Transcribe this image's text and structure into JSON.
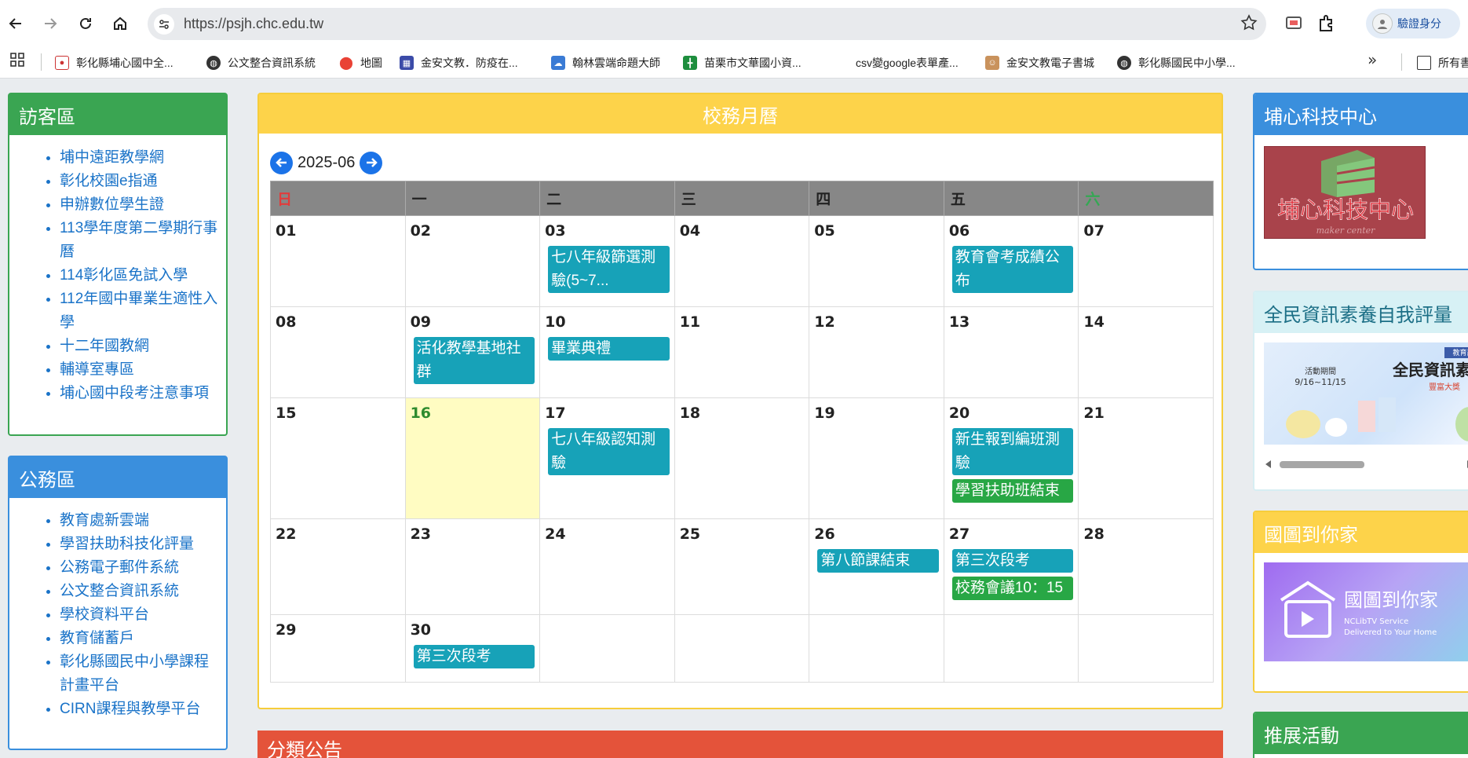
{
  "browser": {
    "url": "https://psjh.chc.edu.tw",
    "verify_label": "驗證身分",
    "bookmarks": [
      "彰化縣埔心國中全...",
      "公文整合資訊系統",
      "地圖",
      "金安文教．防疫在...",
      "翰林雲端命題大師",
      "苗栗市文華國小資...",
      "csv變google表單產...",
      "金安文教電子書城",
      "彰化縣國民中小學..."
    ],
    "all_bookmarks_label": "所有書"
  },
  "visitor": {
    "title": "訪客區",
    "links": [
      "埔中遠距教學網",
      "彰化校園e指通",
      "申辦數位學生證",
      "113學年度第二學期行事曆",
      "114彰化區免試入學",
      "112年國中畢業生適性入學",
      "十二年國教網",
      "輔導室專區",
      "埔心國中段考注意事項"
    ]
  },
  "official": {
    "title": "公務區",
    "links": [
      "教育處新雲端",
      "學習扶助科技化評量",
      "公務電子郵件系統",
      "公文整合資訊系統",
      "學校資料平台",
      "教育儲蓄戶",
      "彰化縣國民中小學課程計畫平台",
      "CIRN課程與教學平台"
    ]
  },
  "calendar": {
    "title": "校務月曆",
    "month": "2025-06",
    "weekdays": [
      "日",
      "一",
      "二",
      "三",
      "四",
      "五",
      "六"
    ],
    "weeks": [
      [
        {
          "day": "01",
          "events": []
        },
        {
          "day": "02",
          "events": []
        },
        {
          "day": "03",
          "events": [
            {
              "text": "七八年級篩選測驗(5~7...",
              "color": "teal"
            }
          ]
        },
        {
          "day": "04",
          "events": []
        },
        {
          "day": "05",
          "events": []
        },
        {
          "day": "06",
          "events": [
            {
              "text": "教育會考成績公布",
              "color": "teal"
            }
          ]
        },
        {
          "day": "07",
          "events": []
        }
      ],
      [
        {
          "day": "08",
          "events": []
        },
        {
          "day": "09",
          "events": [
            {
              "text": "活化教學基地社群",
              "color": "teal"
            }
          ]
        },
        {
          "day": "10",
          "events": [
            {
              "text": "畢業典禮",
              "color": "teal"
            }
          ]
        },
        {
          "day": "11",
          "events": []
        },
        {
          "day": "12",
          "events": []
        },
        {
          "day": "13",
          "events": []
        },
        {
          "day": "14",
          "events": []
        }
      ],
      [
        {
          "day": "15",
          "events": []
        },
        {
          "day": "16",
          "events": [],
          "today": true
        },
        {
          "day": "17",
          "events": [
            {
              "text": "七八年級認知測驗",
              "color": "teal"
            }
          ]
        },
        {
          "day": "18",
          "events": []
        },
        {
          "day": "19",
          "events": []
        },
        {
          "day": "20",
          "events": [
            {
              "text": "新生報到編班測驗",
              "color": "teal"
            },
            {
              "text": "學習扶助班結束",
              "color": "green"
            }
          ]
        },
        {
          "day": "21",
          "events": []
        }
      ],
      [
        {
          "day": "22",
          "events": []
        },
        {
          "day": "23",
          "events": []
        },
        {
          "day": "24",
          "events": []
        },
        {
          "day": "25",
          "events": []
        },
        {
          "day": "26",
          "events": [
            {
              "text": "第八節課結束",
              "color": "teal"
            }
          ]
        },
        {
          "day": "27",
          "events": [
            {
              "text": "第三次段考",
              "color": "teal"
            },
            {
              "text": "校務會議10：15",
              "color": "green"
            }
          ]
        },
        {
          "day": "28",
          "events": []
        }
      ],
      [
        {
          "day": "29",
          "events": []
        },
        {
          "day": "30",
          "events": [
            {
              "text": "第三次段考",
              "color": "teal"
            }
          ]
        },
        {
          "day": "",
          "events": []
        },
        {
          "day": "",
          "events": []
        },
        {
          "day": "",
          "events": []
        },
        {
          "day": "",
          "events": []
        },
        {
          "day": "",
          "events": []
        }
      ]
    ],
    "colors": {
      "teal": "#17a2b8",
      "green": "#28a745",
      "today_bg": "#fffcc2"
    }
  },
  "category": {
    "title": "分類公告"
  },
  "tech": {
    "title": "埔心科技中心",
    "logo_text": "埔心科技中心",
    "logo_sub": "maker center"
  },
  "literacy": {
    "title": "全民資訊素養自我評量",
    "banner_period": "活動期間",
    "banner_dates": "9/16~11/15",
    "banner_title": "全民資訊素",
    "banner_sub": "豐富大獎",
    "banner_tag": "教育部"
  },
  "library": {
    "title": "國圖到你家",
    "banner_title": "國圖到你家",
    "banner_sub1": "NCLibTV Service",
    "banner_sub2": "Delivered to Your Home"
  },
  "promo": {
    "title": "推展活動"
  }
}
